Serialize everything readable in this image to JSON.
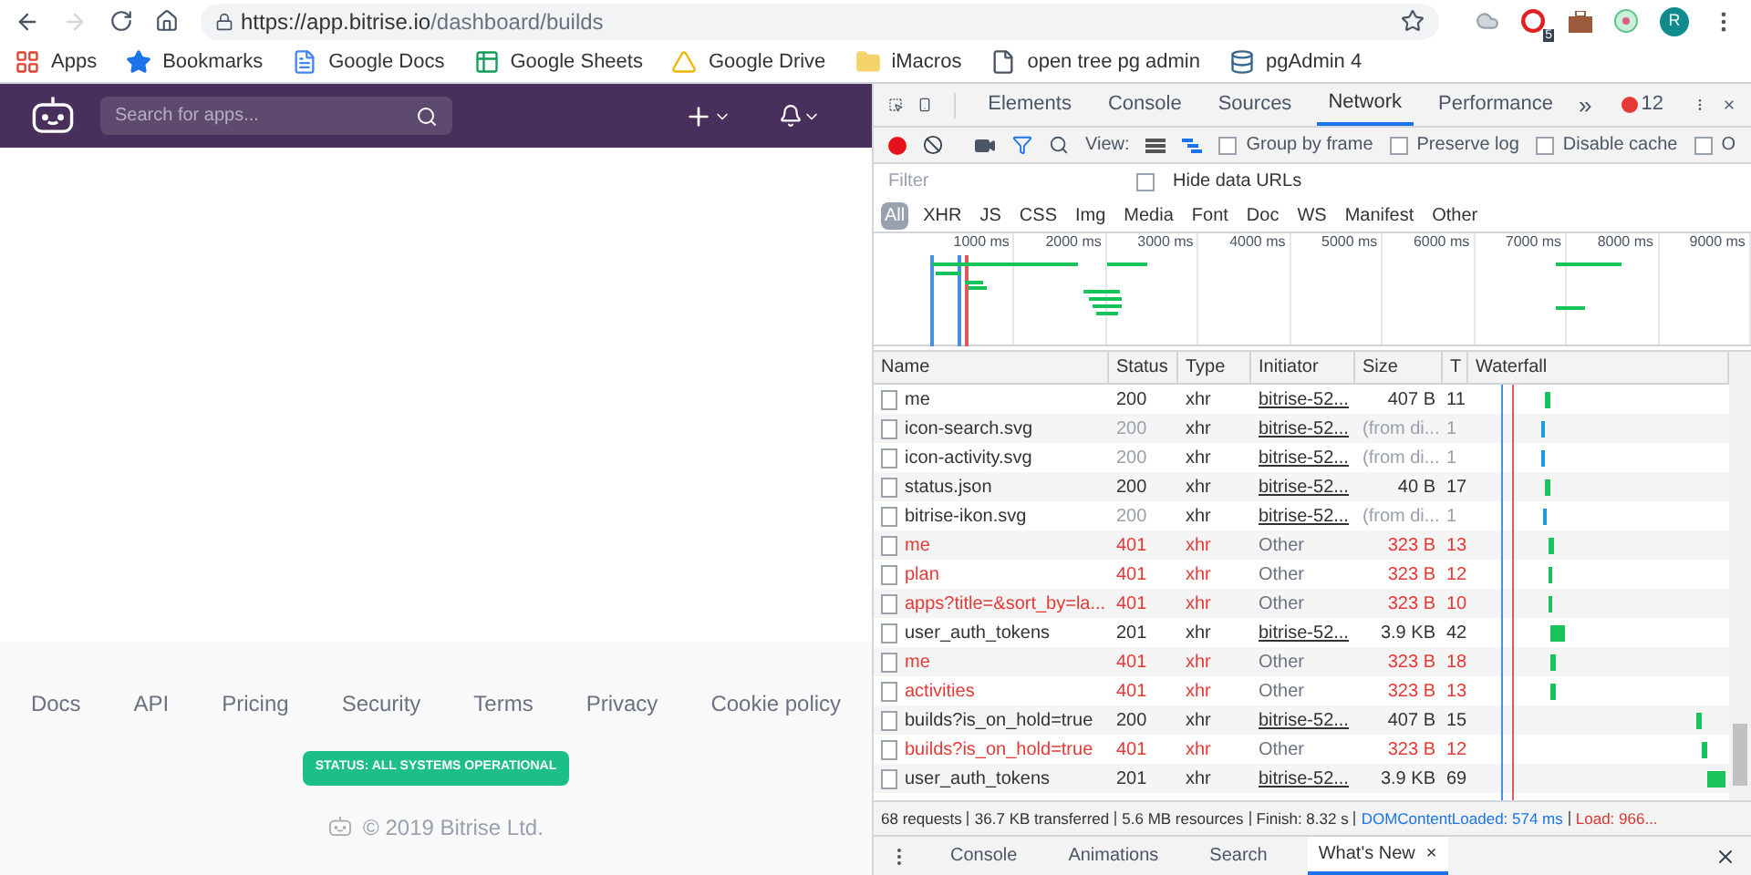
{
  "browser": {
    "url_host": "https://app.bitrise.io",
    "url_path": "/dashboard/builds",
    "profile": "R",
    "extension_badge": "5",
    "bookmarks": [
      "Apps",
      "Bookmarks",
      "Google Docs",
      "Google Sheets",
      "Google Drive",
      "iMacros",
      "open tree pg admin",
      "pgAdmin 4"
    ]
  },
  "site": {
    "search": {
      "placeholder": "Search for apps..."
    },
    "footer_links": [
      "Docs",
      "API",
      "Pricing",
      "Security",
      "Terms",
      "Privacy",
      "Cookie policy"
    ],
    "status_badge": "STATUS: ALL SYSTEMS OPERATIONAL",
    "copyright": "© 2019 Bitrise Ltd."
  },
  "devtools": {
    "tabs": [
      {
        "label": "Elements",
        "selected": false
      },
      {
        "label": "Console",
        "selected": false
      },
      {
        "label": "Sources",
        "selected": false
      },
      {
        "label": "Network",
        "selected": true
      },
      {
        "label": "Performance",
        "selected": false
      }
    ],
    "more": "»",
    "error_count": "12",
    "toolbar": {
      "view_label": "View:",
      "options": [
        {
          "label": "Group by frame",
          "checked": false
        },
        {
          "label": "Preserve log",
          "checked": false
        },
        {
          "label": "Disable cache",
          "checked": false
        },
        {
          "label": "O",
          "checked": false
        }
      ]
    },
    "filter": {
      "placeholder": "Filter",
      "hide_data_urls": {
        "label": "Hide data URLs",
        "checked": false
      }
    },
    "types": [
      {
        "label": "All",
        "selected": true
      },
      {
        "label": "XHR",
        "selected": false
      },
      {
        "label": "JS",
        "selected": false
      },
      {
        "label": "CSS",
        "selected": false
      },
      {
        "label": "Img",
        "selected": false
      },
      {
        "label": "Media",
        "selected": false
      },
      {
        "label": "Font",
        "selected": false
      },
      {
        "label": "Doc",
        "selected": false
      },
      {
        "label": "WS",
        "selected": false
      },
      {
        "label": "Manifest",
        "selected": false
      },
      {
        "label": "Other",
        "selected": false
      }
    ],
    "overview_ticks": [
      "1000 ms",
      "2000 ms",
      "3000 ms",
      "4000 ms",
      "5000 ms",
      "6000 ms",
      "7000 ms",
      "8000 ms",
      "9000 ms"
    ],
    "columns": [
      "Name",
      "Status",
      "Type",
      "Initiator",
      "Size",
      "T",
      "Waterfall"
    ],
    "rows": [
      {
        "name": "me",
        "status": "200",
        "type": "xhr",
        "initiator": "bitrise-52...",
        "size": "407 B",
        "time": "11",
        "kind": "ok"
      },
      {
        "name": "icon-search.svg",
        "status": "200",
        "type": "xhr",
        "initiator": "bitrise-52...",
        "size": "(from di...",
        "time": "1",
        "kind": "cached"
      },
      {
        "name": "icon-activity.svg",
        "status": "200",
        "type": "xhr",
        "initiator": "bitrise-52...",
        "size": "(from di...",
        "time": "1",
        "kind": "cached"
      },
      {
        "name": "status.json",
        "status": "200",
        "type": "xhr",
        "initiator": "bitrise-52...",
        "size": "40 B",
        "time": "17",
        "kind": "ok"
      },
      {
        "name": "bitrise-ikon.svg",
        "status": "200",
        "type": "xhr",
        "initiator": "bitrise-52...",
        "size": "(from di...",
        "time": "1",
        "kind": "cached"
      },
      {
        "name": "me",
        "status": "401",
        "type": "xhr",
        "initiator": "Other",
        "size": "323 B",
        "time": "13",
        "kind": "failed"
      },
      {
        "name": "plan",
        "status": "401",
        "type": "xhr",
        "initiator": "Other",
        "size": "323 B",
        "time": "12",
        "kind": "failed"
      },
      {
        "name": "apps?title=&sort_by=la...",
        "status": "401",
        "type": "xhr",
        "initiator": "Other",
        "size": "323 B",
        "time": "10",
        "kind": "failed"
      },
      {
        "name": "user_auth_tokens",
        "status": "201",
        "type": "xhr",
        "initiator": "bitrise-52...",
        "size": "3.9 KB",
        "time": "42",
        "kind": "ok"
      },
      {
        "name": "me",
        "status": "401",
        "type": "xhr",
        "initiator": "Other",
        "size": "323 B",
        "time": "18",
        "kind": "failed"
      },
      {
        "name": "activities",
        "status": "401",
        "type": "xhr",
        "initiator": "Other",
        "size": "323 B",
        "time": "13",
        "kind": "failed"
      },
      {
        "name": "builds?is_on_hold=true",
        "status": "200",
        "type": "xhr",
        "initiator": "bitrise-52...",
        "size": "407 B",
        "time": "15",
        "kind": "ok"
      },
      {
        "name": "builds?is_on_hold=true",
        "status": "401",
        "type": "xhr",
        "initiator": "Other",
        "size": "323 B",
        "time": "12",
        "kind": "failed"
      },
      {
        "name": "user_auth_tokens",
        "status": "201",
        "type": "xhr",
        "initiator": "bitrise-52...",
        "size": "3.9 KB",
        "time": "69",
        "kind": "ok"
      }
    ],
    "summary": [
      "68 requests",
      "36.7 KB transferred",
      "5.6 MB resources",
      "Finish: 8.32 s"
    ],
    "dom_content_loaded": "DOMContentLoaded: 574 ms",
    "load": "Load: 966...",
    "drawer_tabs": [
      {
        "label": "Console",
        "selected": false,
        "closable": false
      },
      {
        "label": "Animations",
        "selected": false,
        "closable": false
      },
      {
        "label": "Search",
        "selected": false,
        "closable": false
      },
      {
        "label": "What's New",
        "selected": true,
        "closable": true
      }
    ],
    "close_glyph": "×"
  }
}
